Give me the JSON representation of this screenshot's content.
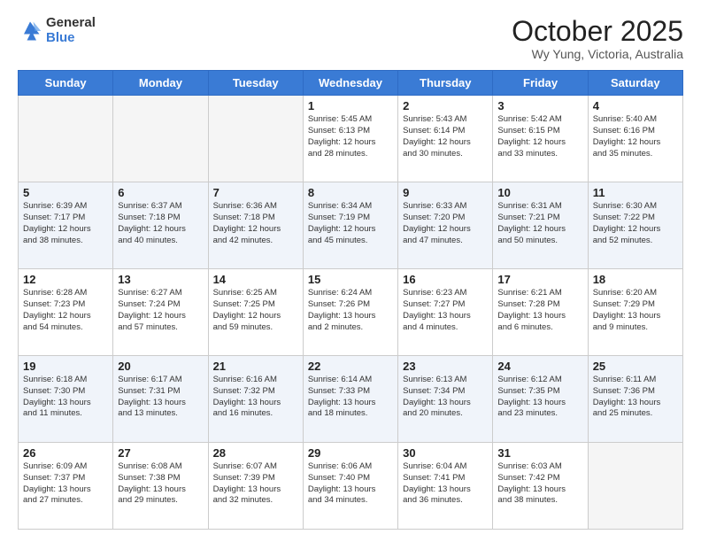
{
  "logo": {
    "general": "General",
    "blue": "Blue"
  },
  "header": {
    "month": "October 2025",
    "location": "Wy Yung, Victoria, Australia"
  },
  "weekdays": [
    "Sunday",
    "Monday",
    "Tuesday",
    "Wednesday",
    "Thursday",
    "Friday",
    "Saturday"
  ],
  "weeks": [
    [
      {
        "day": "",
        "info": ""
      },
      {
        "day": "",
        "info": ""
      },
      {
        "day": "",
        "info": ""
      },
      {
        "day": "1",
        "info": "Sunrise: 5:45 AM\nSunset: 6:13 PM\nDaylight: 12 hours\nand 28 minutes."
      },
      {
        "day": "2",
        "info": "Sunrise: 5:43 AM\nSunset: 6:14 PM\nDaylight: 12 hours\nand 30 minutes."
      },
      {
        "day": "3",
        "info": "Sunrise: 5:42 AM\nSunset: 6:15 PM\nDaylight: 12 hours\nand 33 minutes."
      },
      {
        "day": "4",
        "info": "Sunrise: 5:40 AM\nSunset: 6:16 PM\nDaylight: 12 hours\nand 35 minutes."
      }
    ],
    [
      {
        "day": "5",
        "info": "Sunrise: 6:39 AM\nSunset: 7:17 PM\nDaylight: 12 hours\nand 38 minutes."
      },
      {
        "day": "6",
        "info": "Sunrise: 6:37 AM\nSunset: 7:18 PM\nDaylight: 12 hours\nand 40 minutes."
      },
      {
        "day": "7",
        "info": "Sunrise: 6:36 AM\nSunset: 7:18 PM\nDaylight: 12 hours\nand 42 minutes."
      },
      {
        "day": "8",
        "info": "Sunrise: 6:34 AM\nSunset: 7:19 PM\nDaylight: 12 hours\nand 45 minutes."
      },
      {
        "day": "9",
        "info": "Sunrise: 6:33 AM\nSunset: 7:20 PM\nDaylight: 12 hours\nand 47 minutes."
      },
      {
        "day": "10",
        "info": "Sunrise: 6:31 AM\nSunset: 7:21 PM\nDaylight: 12 hours\nand 50 minutes."
      },
      {
        "day": "11",
        "info": "Sunrise: 6:30 AM\nSunset: 7:22 PM\nDaylight: 12 hours\nand 52 minutes."
      }
    ],
    [
      {
        "day": "12",
        "info": "Sunrise: 6:28 AM\nSunset: 7:23 PM\nDaylight: 12 hours\nand 54 minutes."
      },
      {
        "day": "13",
        "info": "Sunrise: 6:27 AM\nSunset: 7:24 PM\nDaylight: 12 hours\nand 57 minutes."
      },
      {
        "day": "14",
        "info": "Sunrise: 6:25 AM\nSunset: 7:25 PM\nDaylight: 12 hours\nand 59 minutes."
      },
      {
        "day": "15",
        "info": "Sunrise: 6:24 AM\nSunset: 7:26 PM\nDaylight: 13 hours\nand 2 minutes."
      },
      {
        "day": "16",
        "info": "Sunrise: 6:23 AM\nSunset: 7:27 PM\nDaylight: 13 hours\nand 4 minutes."
      },
      {
        "day": "17",
        "info": "Sunrise: 6:21 AM\nSunset: 7:28 PM\nDaylight: 13 hours\nand 6 minutes."
      },
      {
        "day": "18",
        "info": "Sunrise: 6:20 AM\nSunset: 7:29 PM\nDaylight: 13 hours\nand 9 minutes."
      }
    ],
    [
      {
        "day": "19",
        "info": "Sunrise: 6:18 AM\nSunset: 7:30 PM\nDaylight: 13 hours\nand 11 minutes."
      },
      {
        "day": "20",
        "info": "Sunrise: 6:17 AM\nSunset: 7:31 PM\nDaylight: 13 hours\nand 13 minutes."
      },
      {
        "day": "21",
        "info": "Sunrise: 6:16 AM\nSunset: 7:32 PM\nDaylight: 13 hours\nand 16 minutes."
      },
      {
        "day": "22",
        "info": "Sunrise: 6:14 AM\nSunset: 7:33 PM\nDaylight: 13 hours\nand 18 minutes."
      },
      {
        "day": "23",
        "info": "Sunrise: 6:13 AM\nSunset: 7:34 PM\nDaylight: 13 hours\nand 20 minutes."
      },
      {
        "day": "24",
        "info": "Sunrise: 6:12 AM\nSunset: 7:35 PM\nDaylight: 13 hours\nand 23 minutes."
      },
      {
        "day": "25",
        "info": "Sunrise: 6:11 AM\nSunset: 7:36 PM\nDaylight: 13 hours\nand 25 minutes."
      }
    ],
    [
      {
        "day": "26",
        "info": "Sunrise: 6:09 AM\nSunset: 7:37 PM\nDaylight: 13 hours\nand 27 minutes."
      },
      {
        "day": "27",
        "info": "Sunrise: 6:08 AM\nSunset: 7:38 PM\nDaylight: 13 hours\nand 29 minutes."
      },
      {
        "day": "28",
        "info": "Sunrise: 6:07 AM\nSunset: 7:39 PM\nDaylight: 13 hours\nand 32 minutes."
      },
      {
        "day": "29",
        "info": "Sunrise: 6:06 AM\nSunset: 7:40 PM\nDaylight: 13 hours\nand 34 minutes."
      },
      {
        "day": "30",
        "info": "Sunrise: 6:04 AM\nSunset: 7:41 PM\nDaylight: 13 hours\nand 36 minutes."
      },
      {
        "day": "31",
        "info": "Sunrise: 6:03 AM\nSunset: 7:42 PM\nDaylight: 13 hours\nand 38 minutes."
      },
      {
        "day": "",
        "info": ""
      }
    ]
  ]
}
